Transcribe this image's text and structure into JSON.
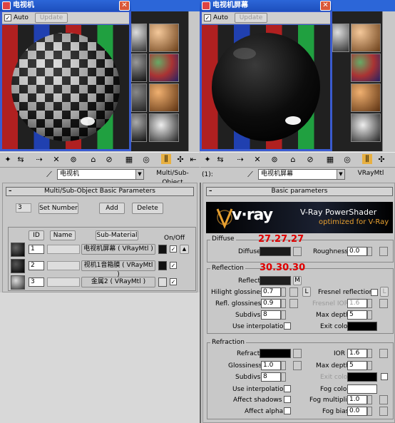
{
  "left_window": {
    "title": "电视机",
    "auto_label": "Auto",
    "update_label": "Update"
  },
  "right_window": {
    "title": "电视机屏幕",
    "auto_label": "Auto",
    "update_label": "Update"
  },
  "left_toolbar": {
    "material_name": "电视机",
    "material_type": "Multi/Sub-Object"
  },
  "right_toolbar": {
    "prefix": "(1):",
    "material_name": "电视机屏幕",
    "material_type": "VRayMtl"
  },
  "multi_sub": {
    "header": "Multi/Sub-Object Basic Parameters",
    "count": "3",
    "set_number_label": "Set Number",
    "add_label": "Add",
    "delete_label": "Delete",
    "col_id": "ID",
    "col_name": "Name",
    "col_submaterial": "Sub-Material",
    "col_onoff": "On/Off",
    "rows": [
      {
        "id": "1",
        "submaterial": "电视机屏幕  ( VRayMtl )"
      },
      {
        "id": "2",
        "submaterial": "视机1音箱膜  ( VRayMtl )"
      },
      {
        "id": "3",
        "submaterial": "金属2  ( VRayMtl )"
      }
    ]
  },
  "vray": {
    "header": "Basic parameters",
    "banner_logo": "v·ray",
    "banner_title": "V-Ray PowerShader",
    "banner_sub": "optimized for V-Ray",
    "diffuse_group": "Diffuse",
    "diffuse_label": "Diffuse",
    "roughness_label": "Roughness",
    "roughness_value": "0.0",
    "reflection_group": "Reflection",
    "reflect_label": "Reflect",
    "reflect_m": "M",
    "hilight_label": "Hilight glossiness",
    "hilight_value": "0.7",
    "hilight_l": "L",
    "fresnel_label": "Fresnel reflections",
    "fresnel_l": "L",
    "refl_gloss_label": "Refl. glossiness",
    "refl_gloss_value": "0.9",
    "fresnel_ior_label": "Fresnel IOR",
    "fresnel_ior_value": "1.6",
    "subdivs_label": "Subdivs",
    "subdivs_value": "8",
    "max_depth_label": "Max depth",
    "max_depth_value": "5",
    "use_interp_label": "Use interpolation",
    "exit_color_label": "Exit color",
    "refraction_group": "Refraction",
    "refract_label": "Refract",
    "ior_label": "IOR",
    "ior_value": "1.6",
    "gloss_label": "Glossiness",
    "gloss_value": "1.0",
    "r_max_depth_label": "Max depth",
    "r_max_depth_value": "5",
    "r_subdivs_label": "Subdivs",
    "r_subdivs_value": "8",
    "r_exit_color_label": "Exit color",
    "r_use_interp_label": "Use interpolation",
    "fog_color_label": "Fog color",
    "affect_shadows_label": "Affect shadows",
    "fog_mult_label": "Fog multiplier",
    "fog_mult_value": "1.0",
    "affect_alpha_label": "Affect alpha",
    "fog_bias_label": "Fog bias",
    "fog_bias_value": "0.0"
  },
  "annotations": {
    "diffuse_rgb": "27.27.27",
    "reflect_rgb": "30.30.30"
  },
  "colors": {
    "titlebar": "#1d4fbd",
    "annotation": "#e00000",
    "panel_bg": "#c8c8c8"
  }
}
